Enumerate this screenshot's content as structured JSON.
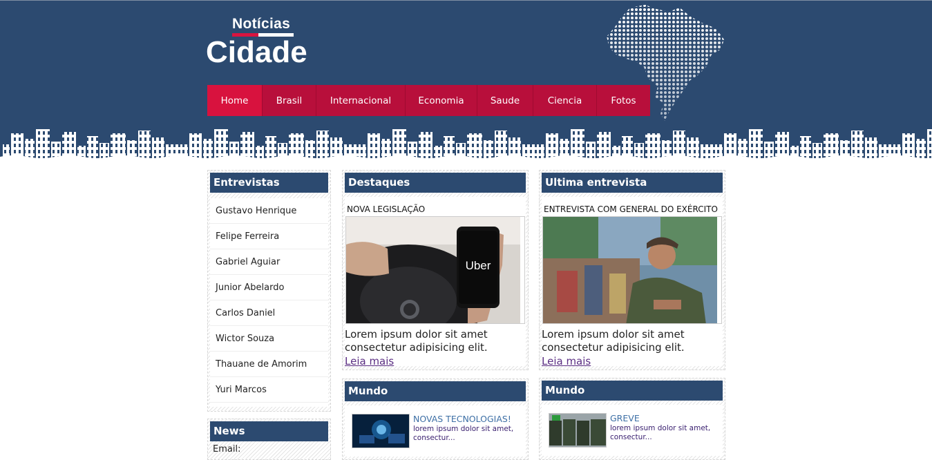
{
  "logo": {
    "line1": "Notícias",
    "line2": "Cidade"
  },
  "nav": {
    "items": [
      {
        "label": "Home",
        "active": true
      },
      {
        "label": "Brasil",
        "active": false
      },
      {
        "label": "Internacional",
        "active": false
      },
      {
        "label": "Economia",
        "active": false
      },
      {
        "label": "Saude",
        "active": false
      },
      {
        "label": "Ciencia",
        "active": false
      },
      {
        "label": "Fotos",
        "active": false
      }
    ]
  },
  "entrevistas": {
    "title": "Entrevistas",
    "items": [
      "Gustavo Henrique",
      "Felipe Ferreira",
      "Gabriel Aguiar",
      "Junior Abelardo",
      "Carlos Daniel",
      "Wictor Souza",
      "Thauane de Amorim",
      "Yuri Marcos"
    ]
  },
  "news": {
    "title": "News",
    "email_label": "Email:"
  },
  "destaques": {
    "title": "Destaques",
    "headline": "NOVA LEGISLAÇÃO",
    "image_text": "Uber",
    "text": "Lorem ipsum dolor sit amet consectetur adipisicing elit.",
    "link": "Leia mais"
  },
  "ultima": {
    "title": "Ultima entrevista",
    "headline": "ENTREVISTA COM GENERAL DO EXÉRCITO",
    "text": "Lorem ipsum dolor sit amet consectetur adipisicing elit.",
    "link": "Leia mais"
  },
  "mundo1": {
    "title": "Mundo",
    "item_title": "NOVAS TECNOLOGIAS!",
    "item_text": "lorem ipsum dolor sit amet, consectur..."
  },
  "mundo2": {
    "title": "Mundo",
    "item_title": "GREVE",
    "item_text": "lorem ipsum dolor sit amet, consectur..."
  },
  "colors": {
    "navy": "#2c4a70",
    "crimson": "#b80f3b",
    "crimson_active": "#d8123e",
    "link_purple": "#5a2d82",
    "mini_title": "#3d6fa5"
  }
}
